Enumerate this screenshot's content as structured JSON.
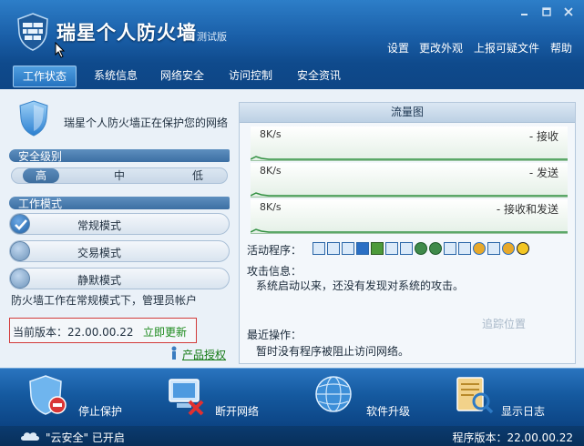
{
  "app": {
    "title": "瑞星个人防火墙",
    "subtitle": "测试版"
  },
  "window_controls": [
    "minimize",
    "maximize",
    "close"
  ],
  "top_menu": [
    "设置",
    "更改外观",
    "上报可疑文件",
    "帮助"
  ],
  "tabs": [
    {
      "label": "工作状态",
      "active": true
    },
    {
      "label": "系统信息",
      "active": false
    },
    {
      "label": "网络安全",
      "active": false
    },
    {
      "label": "访问控制",
      "active": false
    },
    {
      "label": "安全资讯",
      "active": false
    }
  ],
  "status": {
    "protect_text": "瑞星个人防火墙正在保护您的网络"
  },
  "security_level": {
    "section_label": "安全级别",
    "levels": [
      "高",
      "中",
      "低"
    ],
    "selected": "高"
  },
  "work_mode": {
    "section_label": "工作模式",
    "modes": [
      {
        "label": "常规模式",
        "checked": true
      },
      {
        "label": "交易模式",
        "checked": false
      },
      {
        "label": "静默模式",
        "checked": false
      }
    ],
    "description": "防火墙工作在常规模式下，管理员帐户"
  },
  "version": {
    "current_text": "当前版本：22.00.00.22",
    "update_link": "立即更新",
    "license_link": "产品授权"
  },
  "traffic": {
    "title": "流量图",
    "graphs": [
      {
        "rate": "8K/s",
        "label": "- 接收"
      },
      {
        "rate": "8K/s",
        "label": "- 发送"
      },
      {
        "rate": "8K/s",
        "label": "- 接收和发送"
      }
    ]
  },
  "activity": {
    "programs_label": "活动程序：",
    "program_icons": [
      "window-icon",
      "window-icon",
      "window-icon",
      "ie-icon",
      "app-icon",
      "window-icon",
      "window-icon",
      "globe-icon",
      "globe-icon",
      "window-icon",
      "window-icon",
      "ie-icon",
      "window-icon",
      "ie-icon",
      "qq-icon"
    ],
    "attack_label": "攻击信息：",
    "attack_text": "系统启动以来，还没有发现对系统的攻击。",
    "trace_link": "追踪位置",
    "recent_label": "最近操作：",
    "recent_text": "暂时没有程序被阻止访问网络。"
  },
  "toolbar": [
    {
      "label": "停止保护",
      "icon": "shield-stop-icon"
    },
    {
      "label": "断开网络",
      "icon": "network-disconnect-icon"
    },
    {
      "label": "软件升级",
      "icon": "globe-upgrade-icon"
    },
    {
      "label": "显示日志",
      "icon": "log-icon"
    }
  ],
  "statusbar": {
    "cloud_text": "\"云安全\" 已开启",
    "program_version": "程序版本：22.00.00.22"
  },
  "colors": {
    "header_blue": "#1a5fa8",
    "body_bg": "#eaf1f8",
    "update_green": "#1c8a1c",
    "version_border": "#d23a3a"
  }
}
